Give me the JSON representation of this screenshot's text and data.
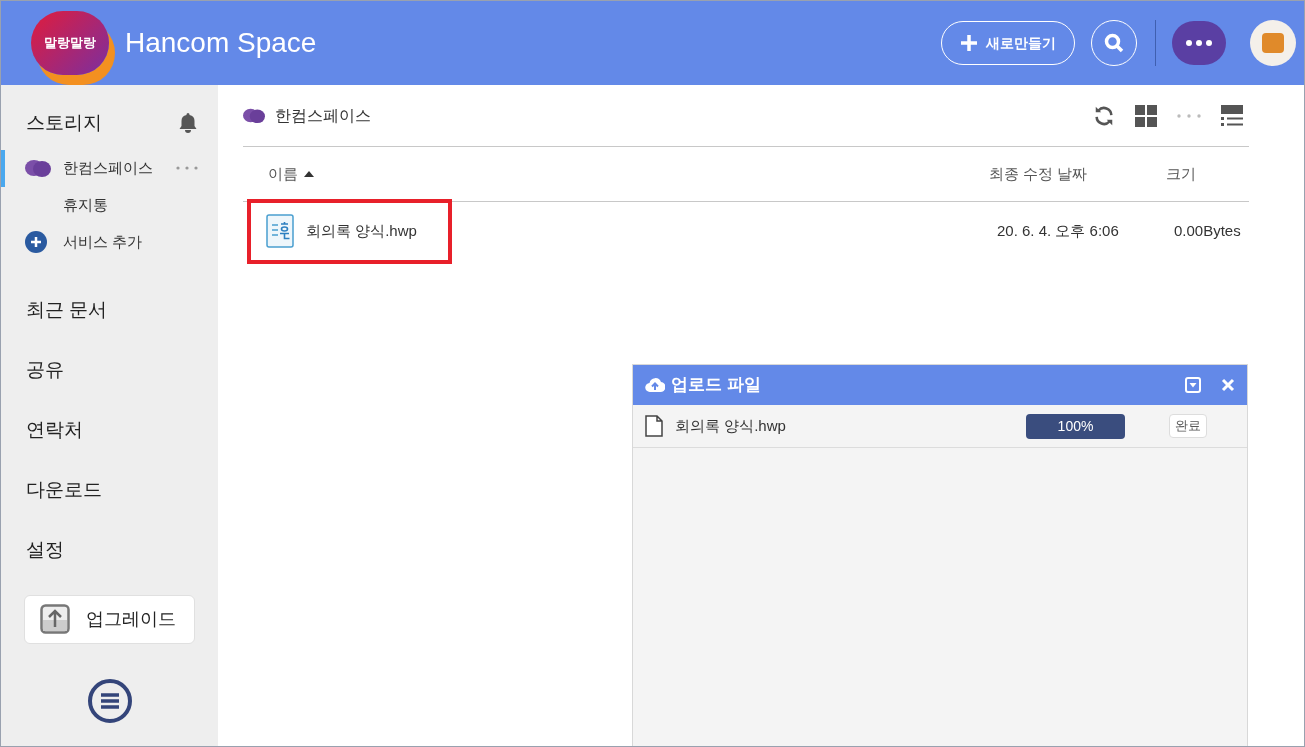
{
  "header": {
    "logo_text": "말랑말랑",
    "title": "Hancom Space",
    "new_button": "새로만들기"
  },
  "sidebar": {
    "storage_title": "스토리지",
    "storage_items": [
      {
        "kind": "space",
        "label": "한컴스페이스",
        "selected": true
      },
      {
        "kind": "trash",
        "label": "휴지통",
        "selected": false
      },
      {
        "kind": "add",
        "label": "서비스 추가",
        "selected": false
      }
    ],
    "nav_items": [
      {
        "label": "최근 문서",
        "selected": false
      },
      {
        "label": "공유",
        "selected": false
      },
      {
        "label": "연락처",
        "selected": false
      },
      {
        "label": "다운로드",
        "selected": false
      },
      {
        "label": "설정",
        "selected": false
      }
    ],
    "upgrade_button": "업그레이드"
  },
  "breadcrumb": "한컴스페이스",
  "table": {
    "columns": [
      {
        "label": "이름",
        "sorted": true
      },
      {
        "label": "최종 수정 날짜",
        "sorted": false
      },
      {
        "label": "크기",
        "sorted": false
      }
    ],
    "rows": [
      {
        "name": "회의록 양식.hwp",
        "modified": "20. 6. 4. 오후 6:06",
        "size": "0.00Bytes",
        "highlighted": true
      }
    ]
  },
  "upload_panel": {
    "title": "업로드 파일",
    "files": [
      {
        "name": "회의록 양식.hwp",
        "level": 1,
        "progress_text": "100%",
        "status": "완료"
      }
    ]
  }
}
